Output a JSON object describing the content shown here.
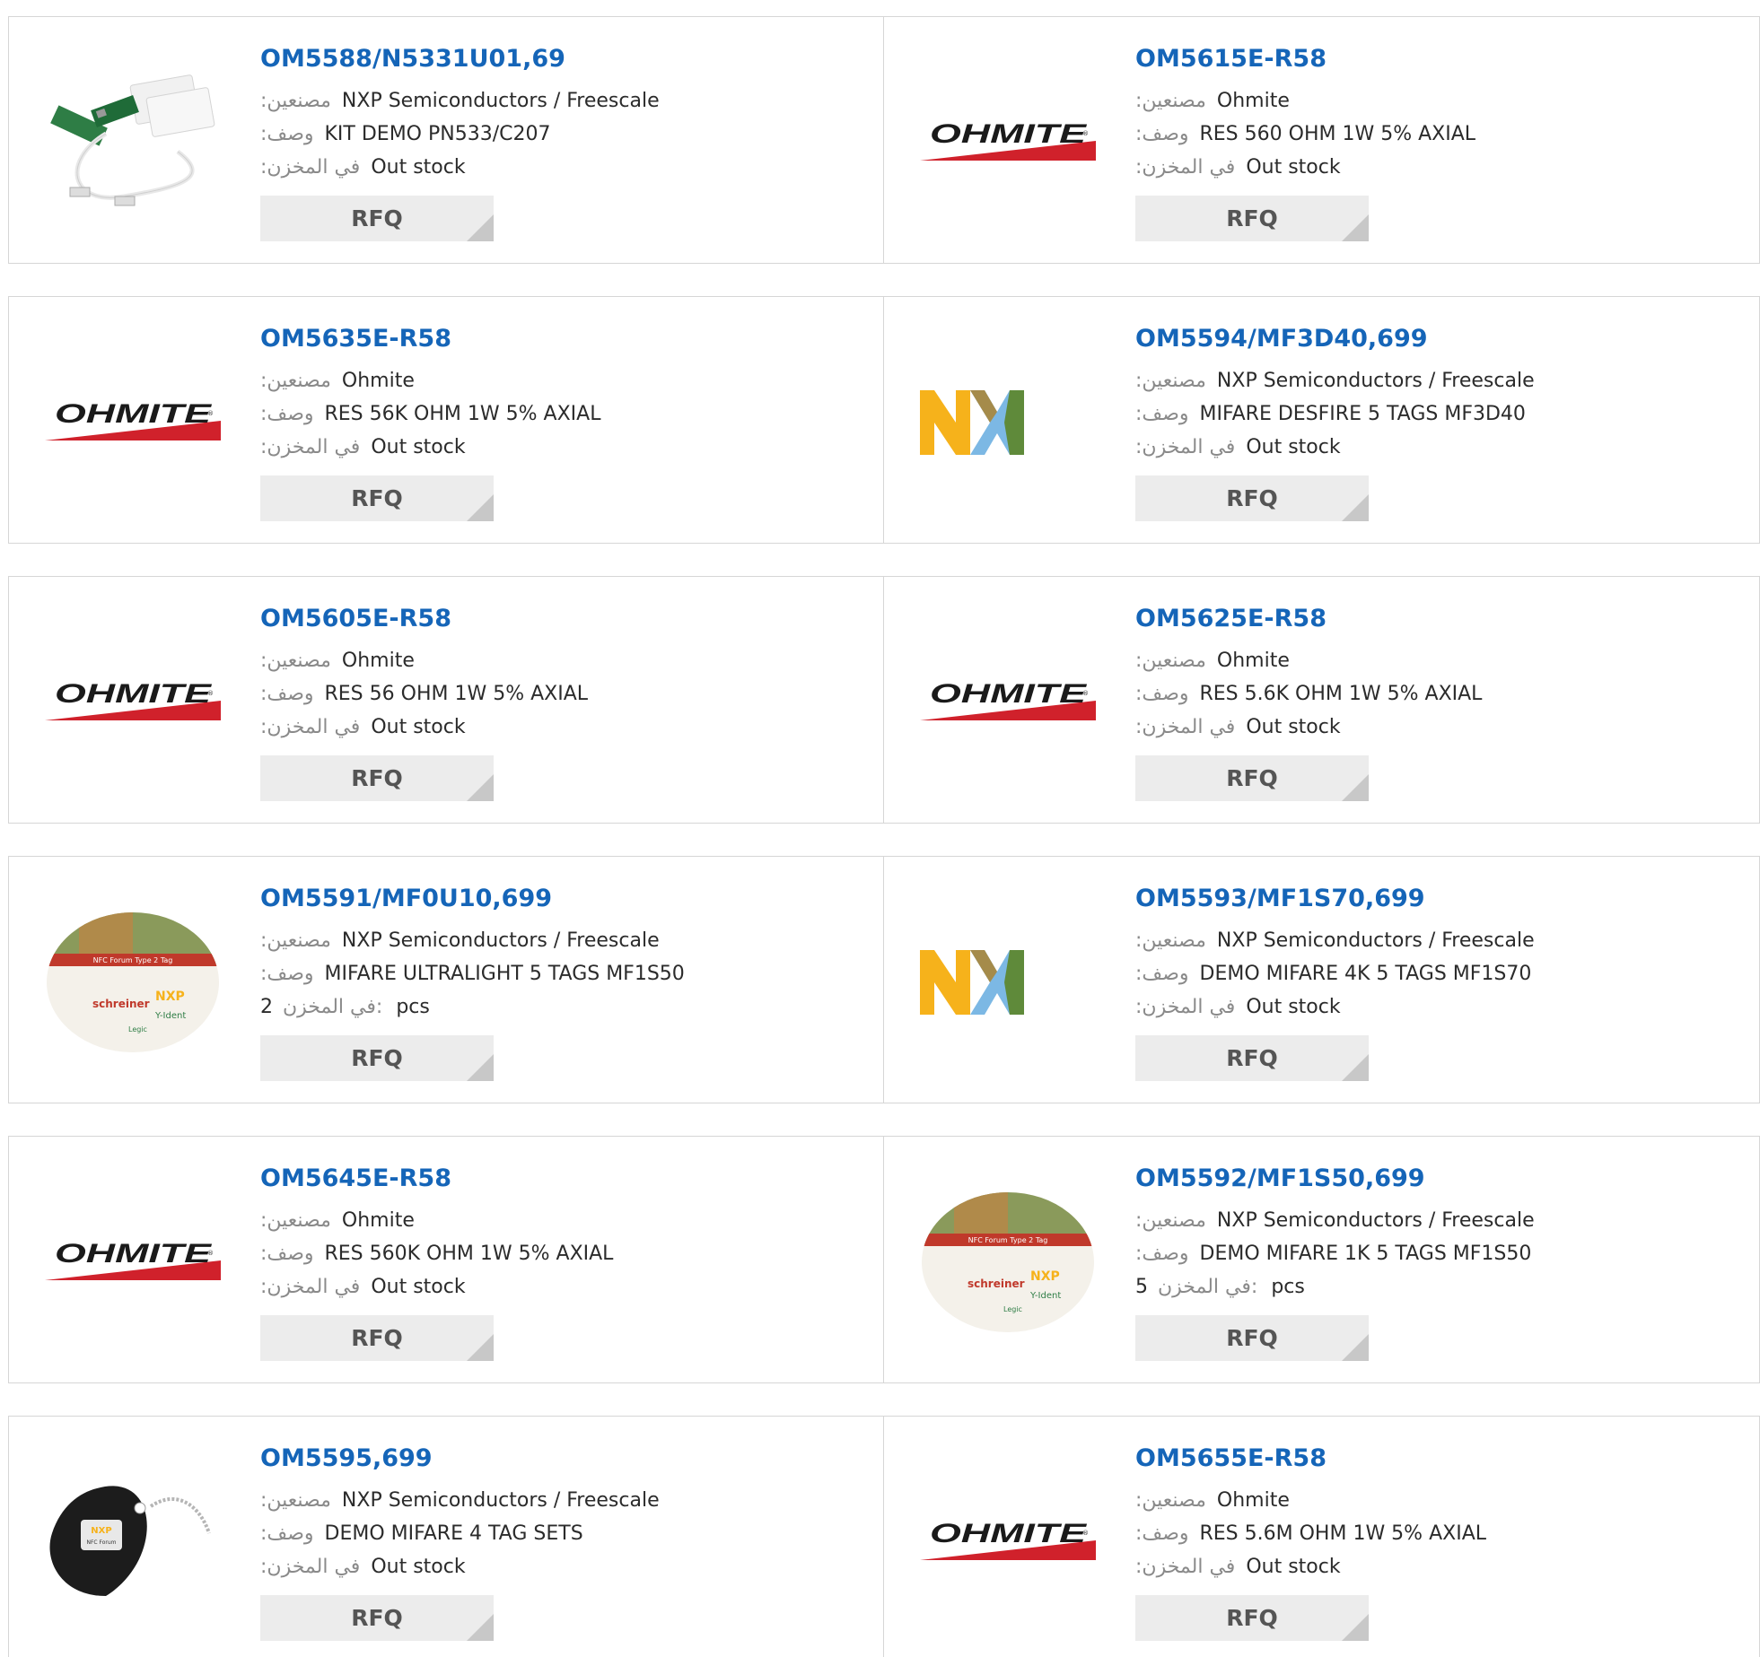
{
  "labels": {
    "manufacturer": ":مصنعين",
    "description": ":وصف",
    "stock": ":في المخزن",
    "stock_prefix": "في المخزن:",
    "pcs": "pcs"
  },
  "rfq_label": "RFQ",
  "colors": {
    "link": "#1565b8",
    "button_bg": "#ececec",
    "border": "#d6d6d6",
    "ohmite_red": "#d0212b"
  },
  "products": [
    {
      "part": "OM5588/N5331U01,69",
      "manufacturer": "NXP Semiconductors / Freescale",
      "description": "KIT DEMO PN533/C207",
      "stock": "Out stock",
      "image": "pn533-demo-kit-photo"
    },
    {
      "part": "OM5615E-R58",
      "manufacturer": "Ohmite",
      "description": "RES 560 OHM 1W 5% AXIAL",
      "stock": "Out stock",
      "image": "ohmite-logo"
    },
    {
      "part": "OM5635E-R58",
      "manufacturer": "Ohmite",
      "description": "RES 56K OHM 1W 5% AXIAL",
      "stock": "Out stock",
      "image": "ohmite-logo"
    },
    {
      "part": "OM5594/MF3D40,699",
      "manufacturer": "NXP Semiconductors / Freescale",
      "description": "MIFARE DESFIRE 5 TAGS MF3D40",
      "stock": "Out stock",
      "image": "nxp-logo"
    },
    {
      "part": "OM5605E-R58",
      "manufacturer": "Ohmite",
      "description": "RES 56 OHM 1W 5% AXIAL",
      "stock": "Out stock",
      "image": "ohmite-logo"
    },
    {
      "part": "OM5625E-R58",
      "manufacturer": "Ohmite",
      "description": "RES 5.6K OHM 1W 5% AXIAL",
      "stock": "Out stock",
      "image": "ohmite-logo"
    },
    {
      "part": "OM5591/MF0U10,699",
      "manufacturer": "NXP Semiconductors / Freescale",
      "description": "MIFARE ULTRALIGHT 5 TAGS MF1S50",
      "stock_qty": "2",
      "image": "nfc-tag-sticker-photo"
    },
    {
      "part": "OM5593/MF1S70,699",
      "manufacturer": "NXP Semiconductors / Freescale",
      "description": "DEMO MIFARE 4K 5 TAGS MF1S70",
      "stock": "Out stock",
      "image": "nxp-logo"
    },
    {
      "part": "OM5645E-R58",
      "manufacturer": "Ohmite",
      "description": "RES 560K OHM 1W 5% AXIAL",
      "stock": "Out stock",
      "image": "ohmite-logo"
    },
    {
      "part": "OM5592/MF1S50,699",
      "manufacturer": "NXP Semiconductors / Freescale",
      "description": "DEMO MIFARE 1K 5 TAGS MF1S50",
      "stock_qty": "5",
      "image": "nfc-tag-sticker-photo"
    },
    {
      "part": "OM5595,699",
      "manufacturer": "NXP Semiconductors / Freescale",
      "description": "DEMO MIFARE 4 TAG SETS",
      "stock": "Out stock",
      "image": "nfc-keyfob-photo"
    },
    {
      "part": "OM5655E-R58",
      "manufacturer": "Ohmite",
      "description": "RES 5.6M OHM 1W 5% AXIAL",
      "stock": "Out stock",
      "image": "ohmite-logo"
    }
  ]
}
